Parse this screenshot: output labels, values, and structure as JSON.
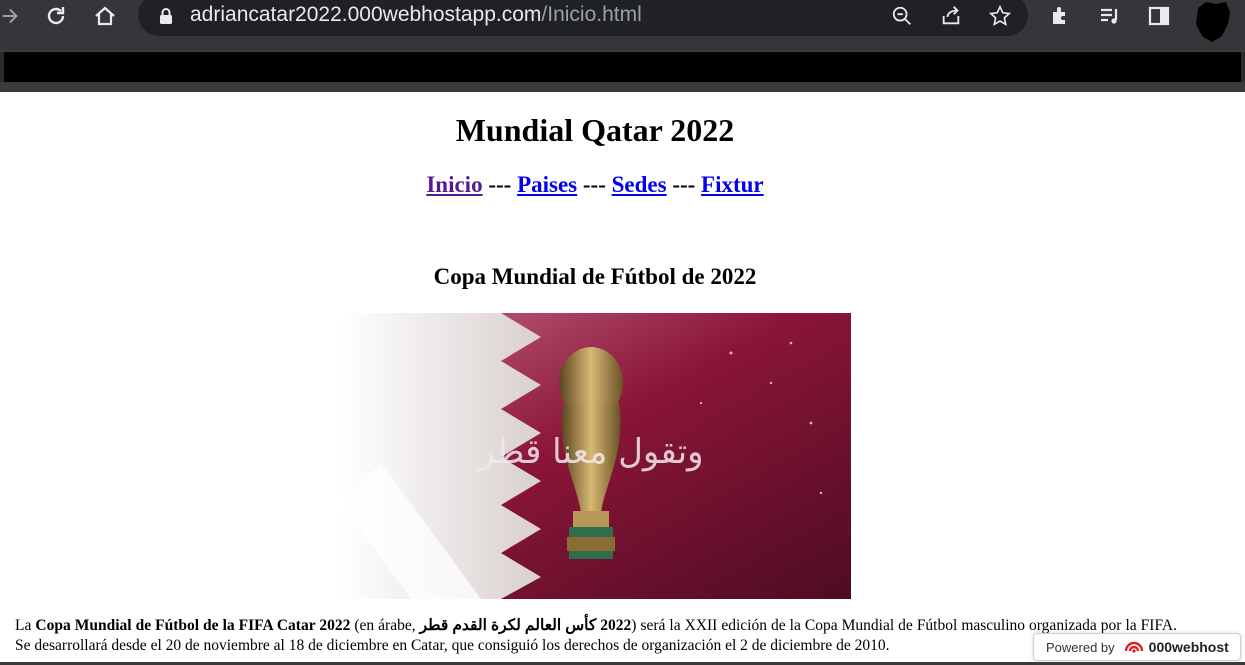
{
  "browser": {
    "url_host": "adriancatar2022.000webhostapp.com",
    "url_path": "/Inicio.html",
    "icons": [
      "forward-icon",
      "reload-icon",
      "home-icon",
      "lock-icon",
      "zoom-icon",
      "share-icon",
      "bookmark-star-icon",
      "extensions-icon",
      "media-control-icon",
      "side-panel-icon",
      "profile-avatar-icon"
    ]
  },
  "page": {
    "title": "Mundial Qatar 2022",
    "nav": {
      "inicio": "Inicio",
      "paises": "Paises",
      "sedes": "Sedes",
      "fixtur": "Fixtur",
      "separator": " --- "
    },
    "subtitle": "Copa Mundial de Fútbol de 2022",
    "hero_image_caption": "وتقول معنا قطر",
    "paragraph": {
      "lead": "La ",
      "bold_name": "Copa Mundial de Fútbol de la FIFA Catar 2022",
      "mid": " (en árabe, ",
      "bold_arabic": "2022 كأس العالم لكرة القدم قطر",
      "rest": ") será la XXII edición de la Copa Mundial de Fútbol masculino organizada por la FIFA. Se desarrollará desde el 20 de noviembre al 18 de diciembre en Catar, que consiguió los derechos de organización el 2 de diciembre de 2010."
    }
  },
  "badge": {
    "powered_by": "Powered by",
    "brand": "000webhost"
  },
  "colors": {
    "chrome": "#35363a",
    "omnibox": "#202124",
    "link": "#0000ee",
    "visited_link": "#551a8b",
    "qatar_maroon": "#8a1538"
  }
}
